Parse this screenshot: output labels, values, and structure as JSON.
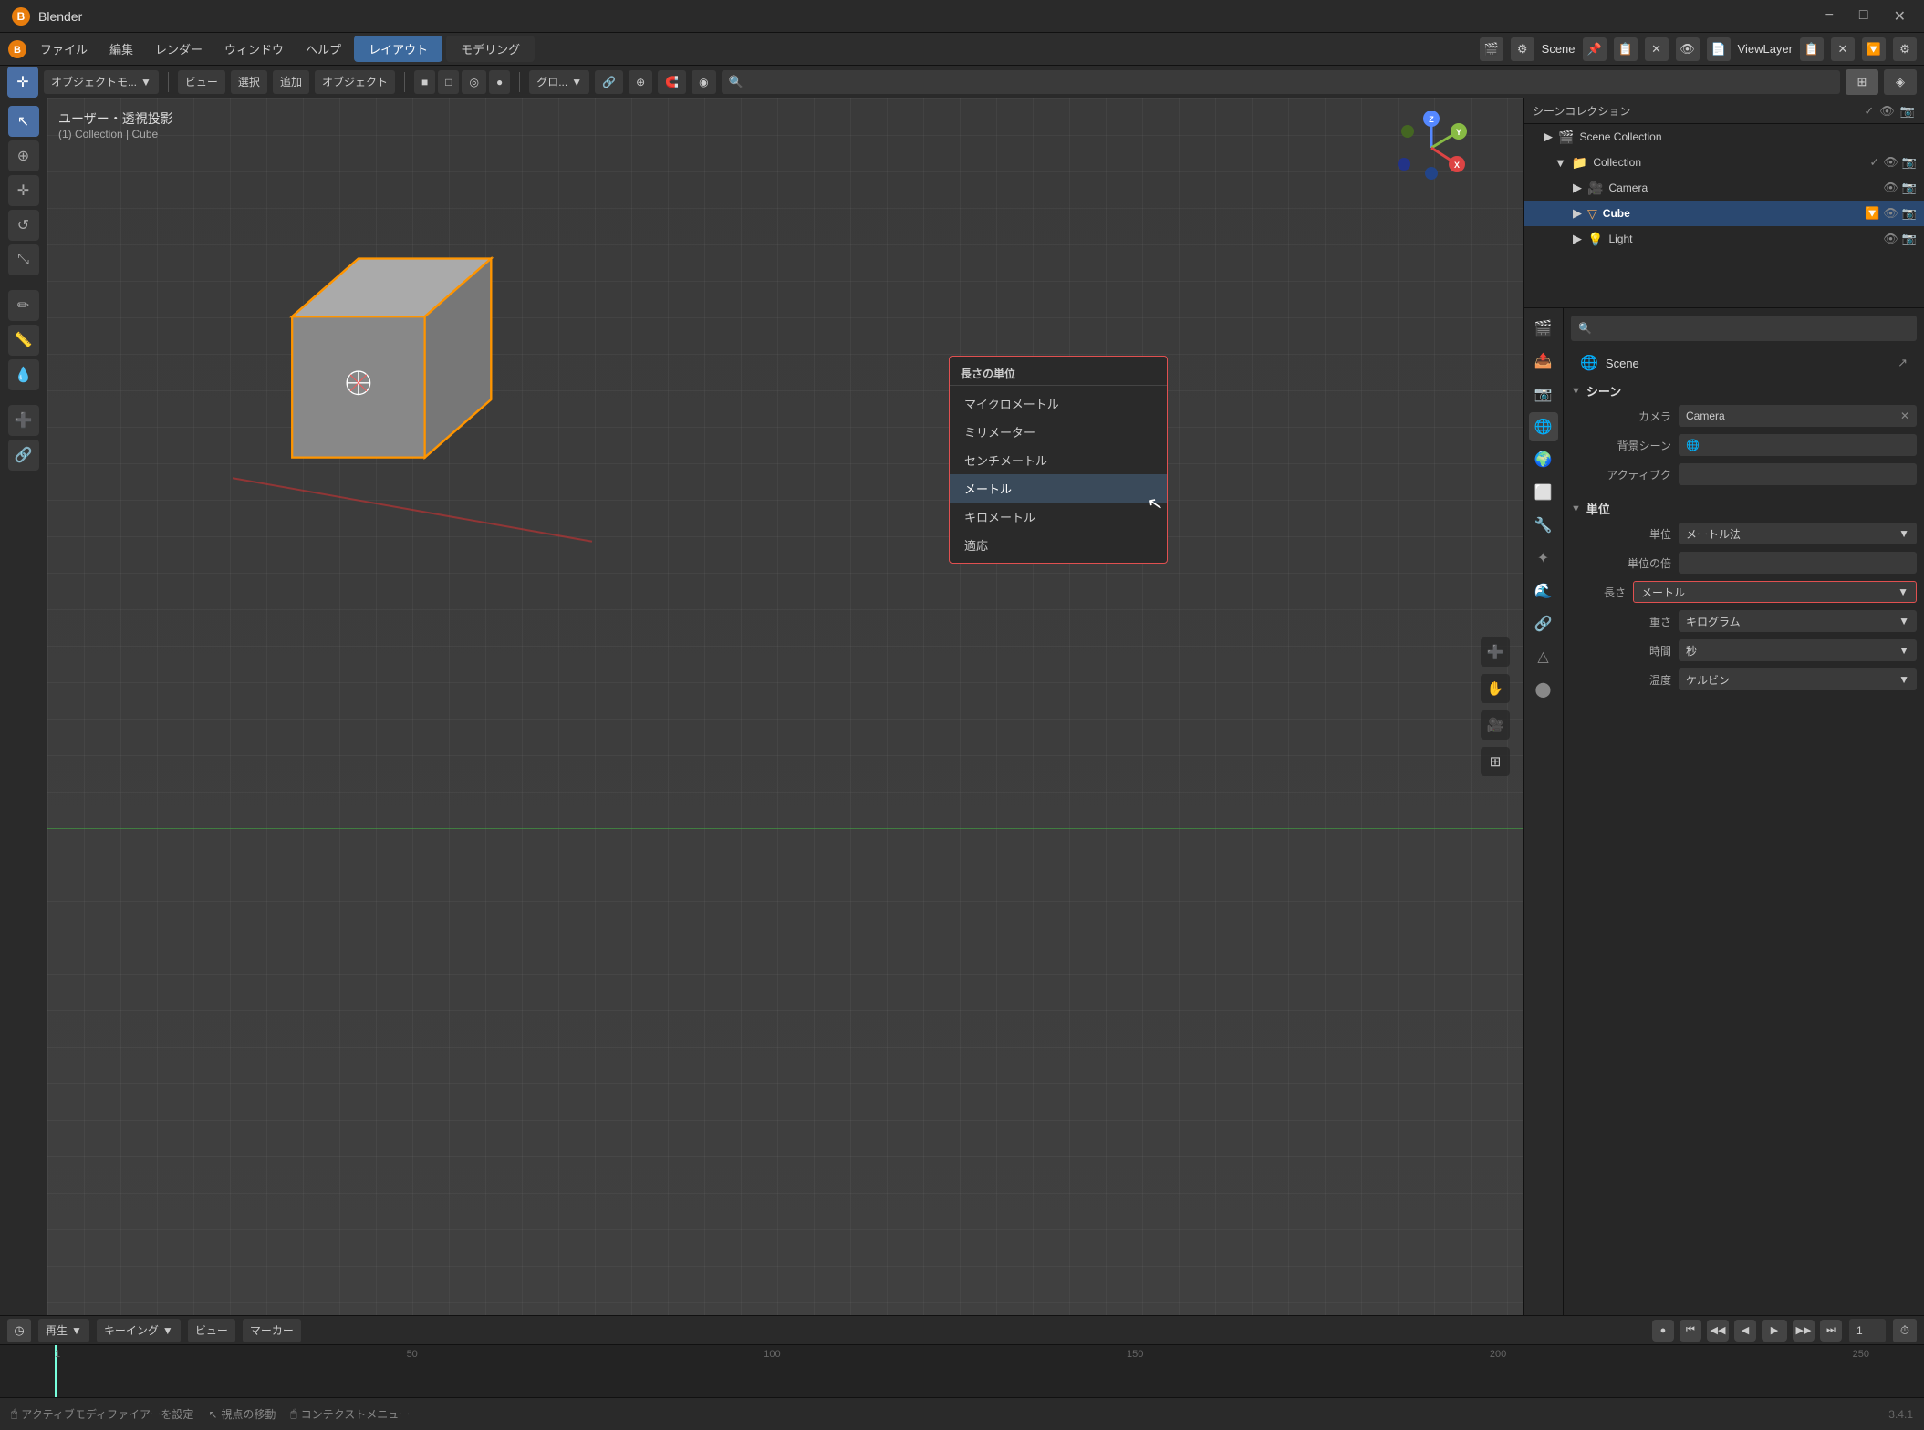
{
  "titlebar": {
    "title": "Blender",
    "minimize": "−",
    "maximize": "□",
    "close": "✕"
  },
  "menubar": {
    "items": [
      "ファイル",
      "編集",
      "レンダー",
      "ウィンドウ",
      "ヘルプ"
    ],
    "active_tab": "レイアウト",
    "inactive_tab": "モデリング",
    "scene_label": "Scene",
    "viewlayer_label": "ViewLayer"
  },
  "toolbar2": {
    "mode_label": "オブジェクトモ...",
    "view_label": "ビュー",
    "select_label": "選択",
    "add_label": "追加",
    "object_label": "オブジェクト",
    "global_label": "グロ...",
    "search_placeholder": "🔍"
  },
  "viewport": {
    "view_label": "ユーザー・透視投影",
    "collection_label": "(1) Collection | Cube"
  },
  "outliner": {
    "title": "シーンコレクション",
    "items": [
      {
        "name": "Collection",
        "indent": 1,
        "icon": "📁",
        "type": "collection"
      },
      {
        "name": "Camera",
        "indent": 2,
        "icon": "🎥",
        "type": "camera"
      },
      {
        "name": "Cube",
        "indent": 2,
        "icon": "▽",
        "type": "mesh",
        "selected": true
      },
      {
        "name": "Light",
        "indent": 2,
        "icon": "💡",
        "type": "light"
      }
    ]
  },
  "properties": {
    "search_placeholder": "🔍",
    "scene_title": "Scene",
    "section_scene": "シーン",
    "camera_label": "カメラ",
    "camera_value": "Camera",
    "bg_scene_label": "背景シーン",
    "active_clip_label": "アクティブク",
    "section_units": "単位",
    "unit_system_label": "単位",
    "unit_system_value": "メートル法",
    "unit_scale_label": "単位の倍",
    "length_label": "長さ",
    "length_value": "メートル",
    "weight_label": "重さ",
    "weight_value": "キログラム",
    "time_label": "時間",
    "time_value": "秒",
    "temp_label": "温度",
    "temp_value": "ケルビン"
  },
  "dropdown": {
    "title": "長さの単位",
    "items": [
      "マイクロメートル",
      "ミリメーター",
      "センチメートル",
      "メートル",
      "キロメートル",
      "適応"
    ]
  },
  "timeline": {
    "play_label": "再生",
    "keying_label": "キーイング",
    "view_label": "ビュー",
    "marker_label": "マーカー",
    "frame_current": "1",
    "numbers": [
      "1",
      "50",
      "100",
      "150",
      "200",
      "250"
    ]
  },
  "statusbar": {
    "item1": "アクティブモディファイアーを設定",
    "item2": "視点の移動",
    "item3": "コンテクストメニュー",
    "version": "3.4.1"
  }
}
